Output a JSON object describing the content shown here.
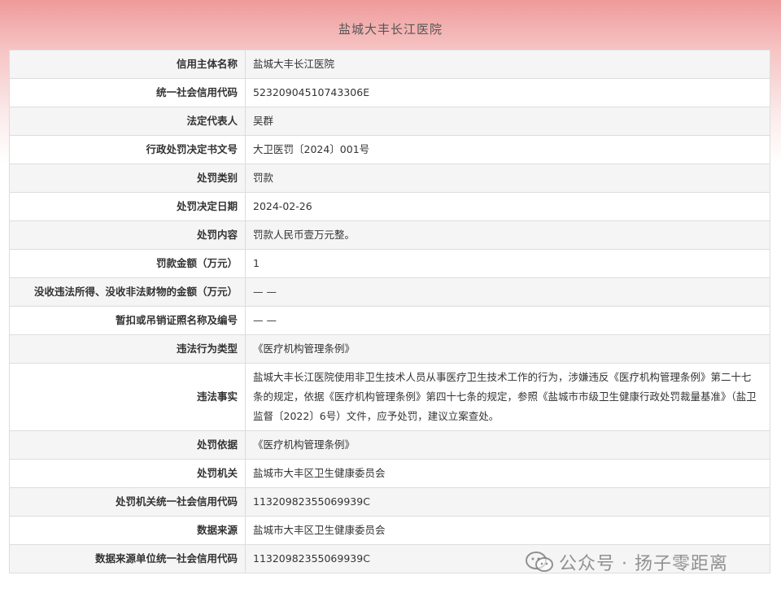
{
  "title": "盐城大丰长江医院",
  "rows": [
    {
      "label": "信用主体名称",
      "value": "盐城大丰长江医院"
    },
    {
      "label": "统一社会信用代码",
      "value": "52320904510743306E"
    },
    {
      "label": "法定代表人",
      "value": "吴群"
    },
    {
      "label": "行政处罚决定书文号",
      "value": "大卫医罚〔2024〕001号"
    },
    {
      "label": "处罚类别",
      "value": "罚款"
    },
    {
      "label": "处罚决定日期",
      "value": "2024-02-26"
    },
    {
      "label": "处罚内容",
      "value": "罚款人民币壹万元整。"
    },
    {
      "label": "罚款金额（万元）",
      "value": "1"
    },
    {
      "label": "没收违法所得、没收非法财物的金额（万元）",
      "value": "— —"
    },
    {
      "label": "暂扣或吊销证照名称及编号",
      "value": "— —"
    },
    {
      "label": "违法行为类型",
      "value": "《医疗机构管理条例》"
    },
    {
      "label": "违法事实",
      "value": "盐城大丰长江医院使用非卫生技术人员从事医疗卫生技术工作的行为，涉嫌违反《医疗机构管理条例》第二十七条的规定，依据《医疗机构管理条例》第四十七条的规定，参照《盐城市市级卫生健康行政处罚裁量基准》（盐卫监督〔2022〕6号）文件，应予处罚，建议立案查处。"
    },
    {
      "label": "处罚依据",
      "value": "《医疗机构管理条例》"
    },
    {
      "label": "处罚机关",
      "value": "盐城市大丰区卫生健康委员会"
    },
    {
      "label": "处罚机关统一社会信用代码",
      "value": "11320982355069939C"
    },
    {
      "label": "数据来源",
      "value": "盐城市大丰区卫生健康委员会"
    },
    {
      "label": "数据来源单位统一社会信用代码",
      "value": "11320982355069939C"
    }
  ],
  "watermark": {
    "text": "公众号 · 扬子零距离",
    "icon": "wechat-icon"
  }
}
